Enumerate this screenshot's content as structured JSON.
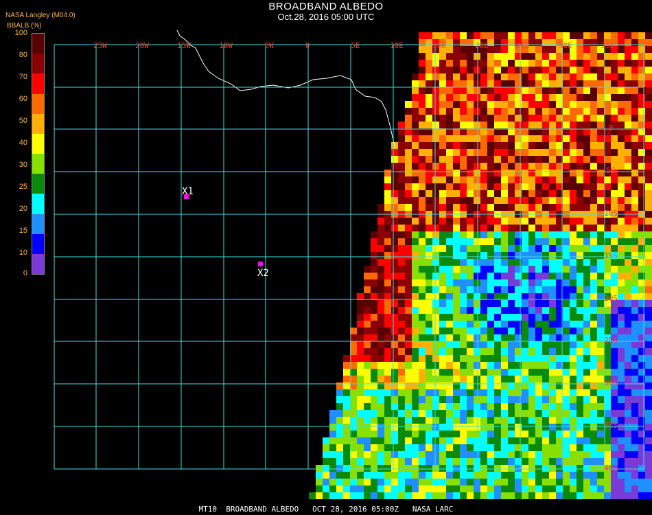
{
  "header": {
    "title": "BROADBAND ALBEDO",
    "subtitle": "Oct.28, 2016 05:00 UTC",
    "source": "NASA Langley (M04.0)"
  },
  "legend": {
    "title": "BBALB (%)",
    "ticks": [
      "100",
      "80",
      "70",
      "60",
      "50",
      "40",
      "30",
      "25",
      "20",
      "15",
      "10",
      "0"
    ],
    "colors": [
      "#5a0000",
      "#8b0000",
      "#ff0000",
      "#ff6a00",
      "#ffb000",
      "#ffff00",
      "#88e000",
      "#0a8a0a",
      "#00ffff",
      "#1e90ff",
      "#0000ff",
      "#7a3ad8"
    ]
  },
  "grid": {
    "lon_labels": [
      "25W",
      "20W",
      "15W",
      "10W",
      "5W",
      "0",
      "5E",
      "10E",
      "15E",
      "20E",
      "25E",
      "30E",
      "35E"
    ],
    "lat_labels": [
      "0",
      "5S",
      "10S",
      "15S",
      "20S",
      "25S",
      "30S",
      "35S",
      "40S"
    ],
    "line_color": "#40e0e0"
  },
  "markers": [
    {
      "label": "X1",
      "color": "#ff00ff"
    },
    {
      "label": "X2",
      "color": "#ff00ff"
    }
  ],
  "footer": {
    "text": "MT10  BROADBAND ALBEDO   OCT 28, 2016 05:00Z   NASA LARC"
  }
}
